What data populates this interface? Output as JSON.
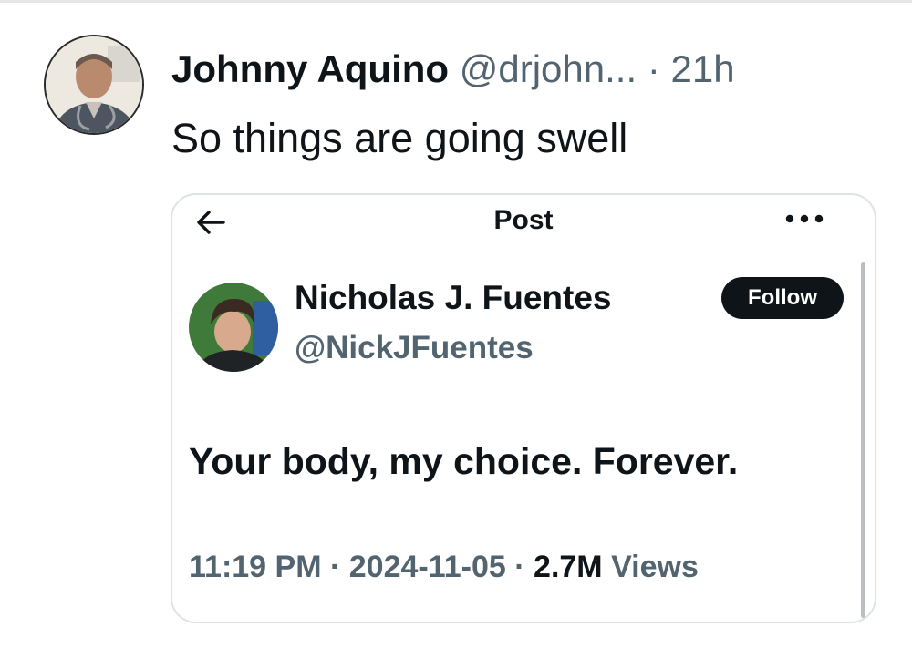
{
  "post": {
    "author_name": "Johnny Aquino",
    "author_handle": "@drjohn...",
    "separator": "·",
    "time": "21h",
    "text": "So things are going swell"
  },
  "embed": {
    "title": "Post",
    "author_name": "Nicholas J. Fuentes",
    "author_handle": "@NickJFuentes",
    "follow_label": "Follow",
    "text": "Your body, my choice. Forever.",
    "time": "11:19 PM",
    "separator": "·",
    "date": "2024-11-05",
    "views_count": "2.7M",
    "views_label": "Views"
  },
  "icons": {
    "back": "left-arrow-icon",
    "more": "more-horizontal-icon"
  },
  "colors": {
    "text_primary": "#0f1419",
    "text_secondary": "#536471",
    "follow_bg": "#0f1419",
    "follow_text": "#ffffff",
    "border": "#dfe3e6"
  }
}
